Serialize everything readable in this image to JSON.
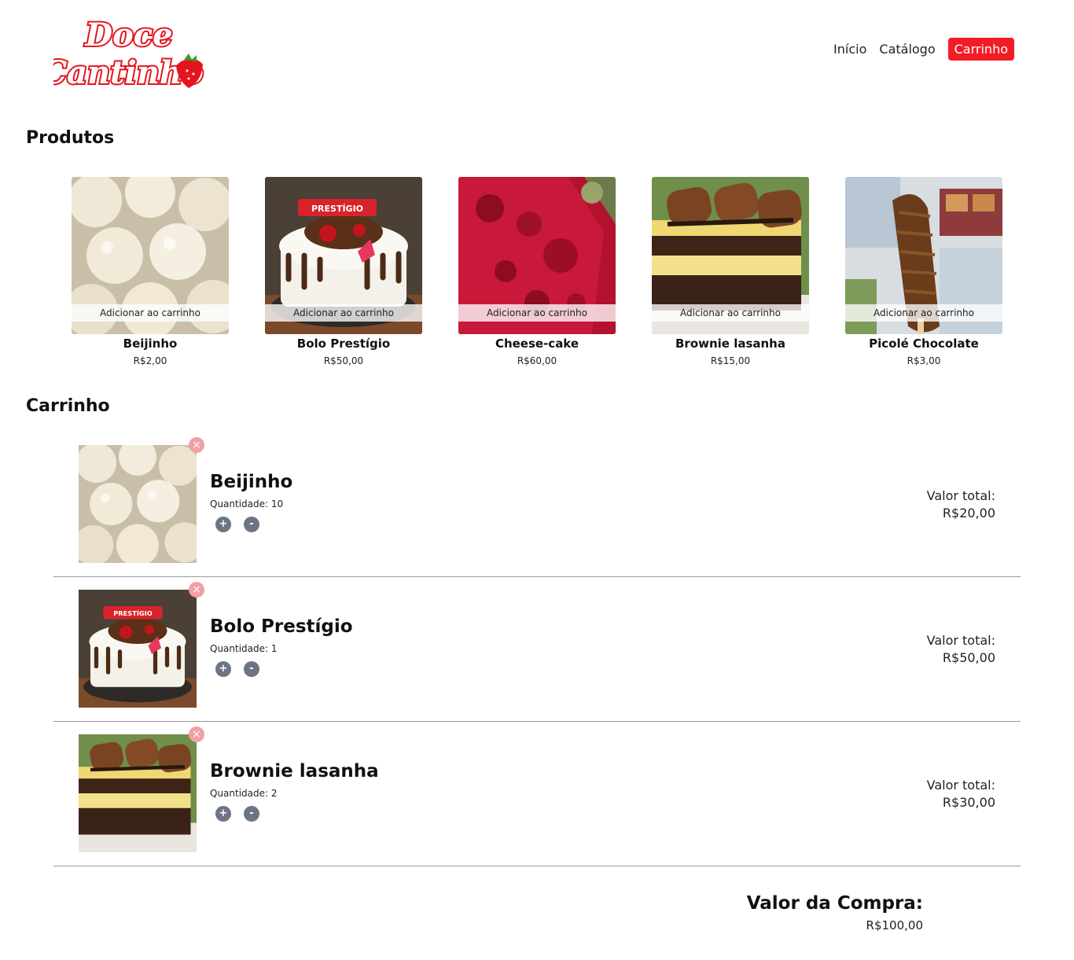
{
  "brand": {
    "logo_line1": "Doce",
    "logo_line2": "Cantinho",
    "logo_color": "#e3161f"
  },
  "nav": {
    "items": [
      "Início",
      "Catálogo",
      "Carrinho"
    ],
    "active": "Carrinho",
    "active_color": "#f21d24"
  },
  "products_section": {
    "title": "Produtos",
    "add_label": "Adicionar ao carrinho"
  },
  "products": [
    {
      "name": "Beijinho",
      "price": "R$2,00",
      "image": "beijinho-image"
    },
    {
      "name": "Bolo Prestígio",
      "price": "R$50,00",
      "image": "bolo-prestigio-image"
    },
    {
      "name": "Cheese-cake",
      "price": "R$60,00",
      "image": "cheesecake-image"
    },
    {
      "name": "Brownie lasanha",
      "price": "R$15,00",
      "image": "brownie-lasanha-image"
    },
    {
      "name": "Picolé Chocolate",
      "price": "R$3,00",
      "image": "picole-chocolate-image"
    }
  ],
  "cart_section": {
    "title": "Carrinho",
    "total_label": "Valor total:",
    "plus": "+",
    "minus": "-",
    "remove_icon": "×"
  },
  "cart": [
    {
      "name": "Beijinho",
      "quantity_text": "Quantidade: 10",
      "total": "R$20,00"
    },
    {
      "name": "Bolo Prestígio",
      "quantity_text": "Quantidade: 1",
      "total": "R$50,00"
    },
    {
      "name": "Brownie lasanha",
      "quantity_text": "Quantidade: 2",
      "total": "R$30,00"
    }
  ],
  "summary": {
    "label": "Valor da Compra:",
    "value": "R$100,00"
  }
}
